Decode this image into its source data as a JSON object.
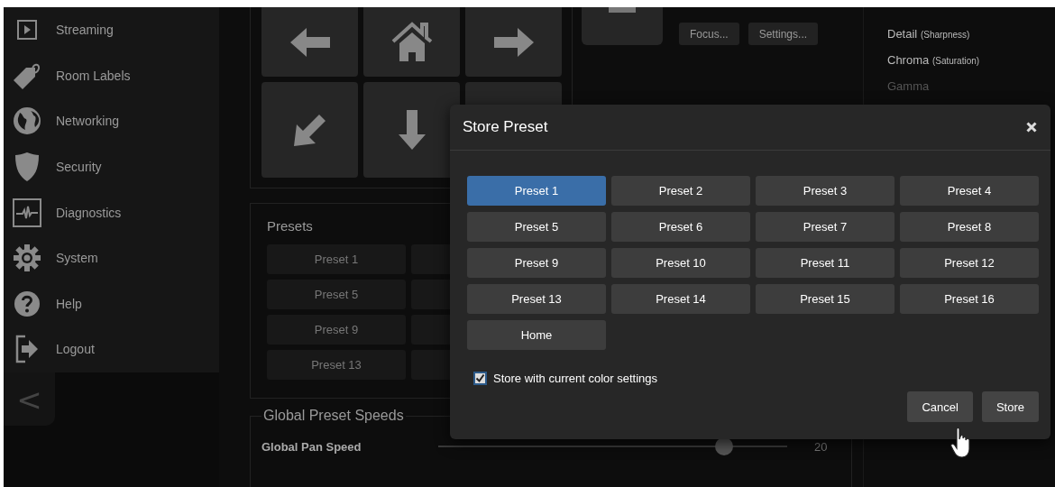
{
  "sidebar": {
    "items": [
      {
        "label": "Streaming"
      },
      {
        "label": "Room Labels"
      },
      {
        "label": "Networking"
      },
      {
        "label": "Security"
      },
      {
        "label": "Diagnostics"
      },
      {
        "label": "System"
      },
      {
        "label": "Help"
      },
      {
        "label": "Logout"
      }
    ],
    "collapse_button": "<"
  },
  "camera_controls": {
    "buttons": [
      "Focus...",
      "Settings..."
    ]
  },
  "presets_panel": {
    "title": "Presets",
    "buttons": [
      "Preset 1",
      "Preset 5",
      "Preset 9",
      "Preset 13"
    ]
  },
  "speeds": {
    "title": "Global Preset Speeds",
    "sliders": [
      {
        "label": "Global Pan Speed",
        "level": 0.82,
        "reading": "20"
      }
    ]
  },
  "color_panel": {
    "items": [
      {
        "label": "Detail",
        "hint": "(Sharpness)",
        "disabled": false
      },
      {
        "label": "Chroma",
        "hint": "(Saturation)",
        "disabled": false
      },
      {
        "label": "Gamma",
        "disabled": true
      }
    ]
  },
  "dialog": {
    "title": "Store Preset",
    "presets": [
      {
        "label": "Preset 1",
        "selected": true
      },
      {
        "label": "Preset 2",
        "selected": false
      },
      {
        "label": "Preset 3",
        "selected": false
      },
      {
        "label": "Preset 4",
        "selected": false
      },
      {
        "label": "Preset 5",
        "selected": false
      },
      {
        "label": "Preset 6",
        "selected": false
      },
      {
        "label": "Preset 7",
        "selected": false
      },
      {
        "label": "Preset 8",
        "selected": false
      },
      {
        "label": "Preset 9",
        "selected": false
      },
      {
        "label": "Preset 10",
        "selected": false
      },
      {
        "label": "Preset 11",
        "selected": false
      },
      {
        "label": "Preset 12",
        "selected": false
      },
      {
        "label": "Preset 13",
        "selected": false
      },
      {
        "label": "Preset 14",
        "selected": false
      },
      {
        "label": "Preset 15",
        "selected": false
      },
      {
        "label": "Preset 16",
        "selected": false
      },
      {
        "label": "Home",
        "selected": false
      }
    ],
    "store_color": {
      "label": "Store with current color settings",
      "checked": true
    },
    "buttons": [
      "Cancel",
      "Store"
    ]
  }
}
